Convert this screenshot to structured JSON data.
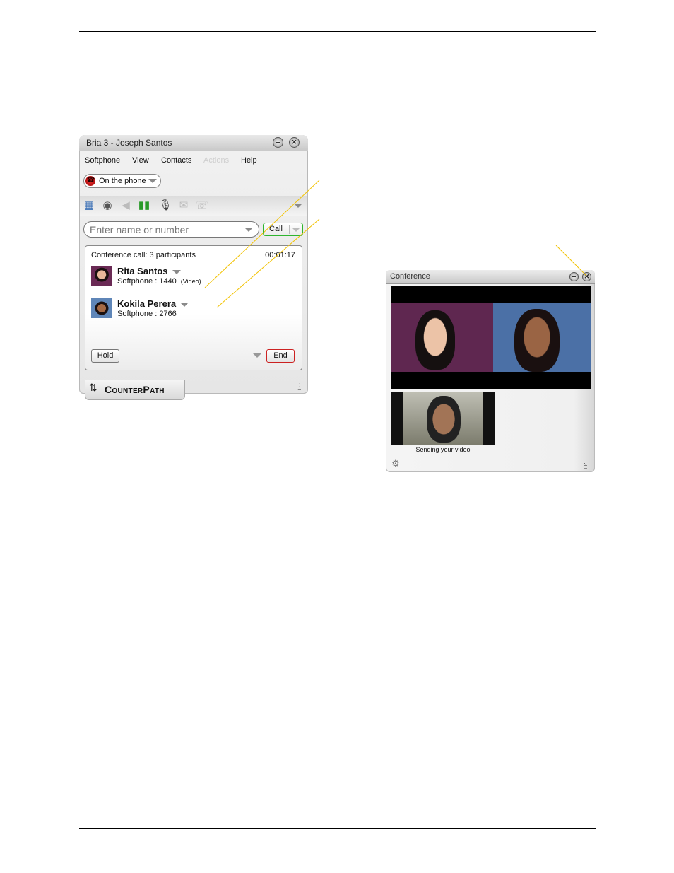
{
  "bria_window": {
    "title": "Bria 3 - Joseph Santos",
    "window_buttons": {
      "minimize": "–",
      "close": "×"
    },
    "menu": [
      {
        "label": "Softphone",
        "enabled": true
      },
      {
        "label": "View",
        "enabled": true
      },
      {
        "label": "Contacts",
        "enabled": true
      },
      {
        "label": "Actions",
        "enabled": false
      },
      {
        "label": "Help",
        "enabled": true
      }
    ],
    "presence": {
      "label": "On the phone",
      "icon": "red-phone-icon"
    },
    "toolbar_icons": [
      "dialpad-icon",
      "webcam-icon",
      "speaker-icon",
      "volume-meter-icon",
      "microphone-icon",
      "mail-icon",
      "transfer-icon"
    ],
    "dial": {
      "placeholder": "Enter name or number",
      "value": "",
      "call_label": "Call"
    },
    "conference": {
      "header": "Conference call: 3 participants",
      "timer": "00:01:17",
      "participants": [
        {
          "name": "Rita Santos",
          "info": "Softphone : 1440",
          "badge": "(Video)"
        },
        {
          "name": "Kokila Perera",
          "info": "Softphone : 2766",
          "badge": ""
        }
      ],
      "hold_label": "Hold",
      "end_label": "End"
    },
    "logo": "CounterPath"
  },
  "conference_window": {
    "title": "Conference",
    "window_buttons": {
      "minimize": "–",
      "close": "×"
    },
    "self_video_caption": "Sending your video"
  },
  "colors": {
    "call_border": "#2fb52f",
    "end_border": "#cc2222",
    "callout_line": "#f2c200",
    "video_left_bg": "#5f2750",
    "video_right_bg": "#4b70a6"
  }
}
